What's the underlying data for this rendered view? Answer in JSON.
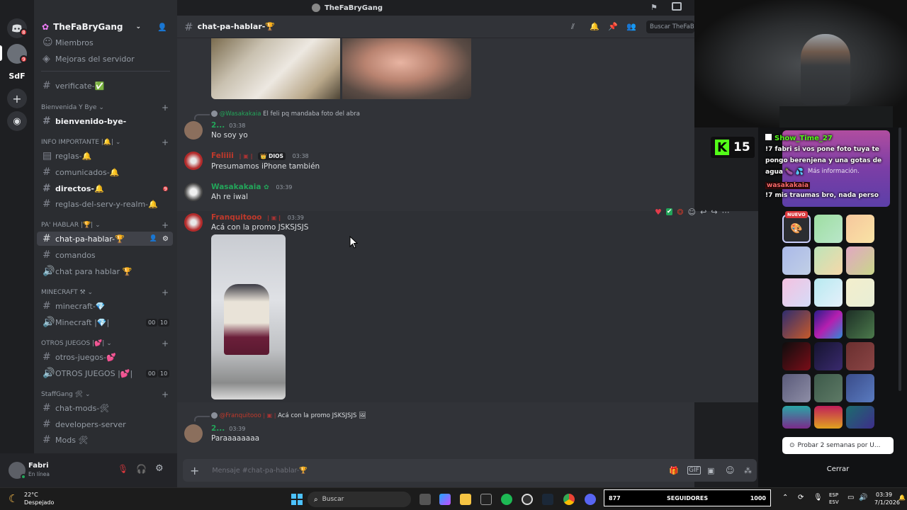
{
  "window": {
    "title": "TheFaBryGang"
  },
  "rail": {
    "sdf_label": "SdF",
    "badge_home": "8",
    "badge_server": "9"
  },
  "server": {
    "name": "TheFaBryGang"
  },
  "channels": {
    "top_items": [
      {
        "label": "Miembros",
        "icon": "members-icon"
      },
      {
        "label": "Mejoras del servidor",
        "icon": "boost-icon"
      }
    ],
    "verificate": "verificate-✅",
    "cat_bienvenida": "Bienvenida Y Bye",
    "bienvenido": "bienvenido-bye-",
    "cat_info": "INFO IMPORTANTE |🔔|",
    "reglas": "reglas-🔔",
    "comunicados": "comunicados-🔔",
    "directos": "directos-🔔",
    "directos_badge": "9",
    "reglas_serv": "reglas-del-serv-y-realm-🔔",
    "cat_pahablar": "PA' HABLAR |🏆|",
    "chat_pa_hablar": "chat-pa-hablar-🏆",
    "comandos": "comandos",
    "chat_para_hablar": "chat para hablar 🏆",
    "cat_minecraft": "MINECRAFT ⚒",
    "minecraft_ch": "minecraft-💎",
    "minecraft_voice": "Minecraft |💎|",
    "voice_00": "00",
    "voice_10": "10",
    "cat_otros": "OTROS JUEGOS |💕|",
    "otros_juegos_ch": "otros-juegos-💕",
    "otros_voice": "OTROS JUEGOS |💕|",
    "cat_staff": "StaffGang 🛠",
    "chat_mods": "chat-mods-🛠",
    "developers": "developers-server",
    "mods": "Mods 🛠"
  },
  "user_panel": {
    "name": "Fabri",
    "status": "En línea"
  },
  "header": {
    "channel": "chat-pa-hablar-🏆",
    "search_placeholder": "Buscar TheFaBr"
  },
  "messages": [
    {
      "reply_author": "@Wasakakaia",
      "reply_text": "El feli pq mandaba foto del abra",
      "author": "2...",
      "time": "03:38",
      "text": "No soy yo"
    },
    {
      "author": "Feliiii",
      "role": "DIOS",
      "time": "03:38",
      "text": "Presumamos iPhone también"
    },
    {
      "author": "Wasakakaia",
      "time": "03:39",
      "text": "Ah re iwal"
    },
    {
      "author": "Franquitooo",
      "time": "03:39",
      "text": "Acá con la promo JSKSJSJS"
    },
    {
      "reply_author": "@Franquitooo",
      "reply_text": "Acá con la promo JSKSJSJS",
      "author": "2...",
      "time": "03:39",
      "text": "Paraaaaaaaa"
    }
  ],
  "composer": {
    "placeholder": "Mensaje #chat-pa-hablar-🏆"
  },
  "overlay": {
    "counter": "15",
    "chat": [
      {
        "user": "Show_Time_27",
        "text": "!7 fabri si vos pone foto tuya te pongo berenjena y una gotas de agua 🍆 💦"
      },
      {
        "user": "wasakakaia",
        "text": "!7 mis traumas bro, nada perso"
      }
    ],
    "behind_text": "Más información."
  },
  "nitro_panel": {
    "new_tag": "NUEVO",
    "trial_button": "Probar 2 semanas por U...",
    "close_button": "Cerrar"
  },
  "taskbar": {
    "weather_temp": "22°C",
    "weather_desc": "Despejado",
    "search": "Buscar",
    "followers_count": "877",
    "followers_label": "SEGUIDORES",
    "followers_goal": "1000",
    "lang": "ESP",
    "lang2": "ESV",
    "clock_time": "03:39",
    "clock_date": "7/1/2026"
  },
  "colors": {
    "accent": "#5865f2",
    "green": "#23a55a",
    "red": "#da373c",
    "kick": "#53fc18"
  }
}
